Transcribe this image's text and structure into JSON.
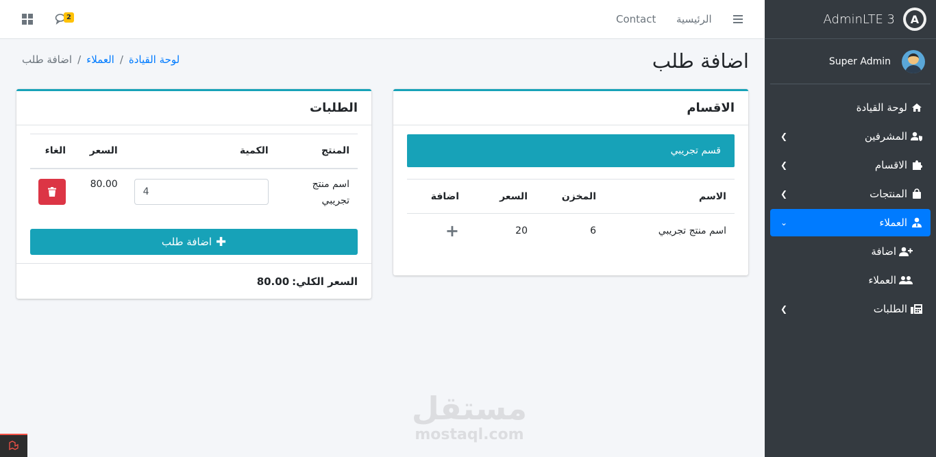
{
  "brand": {
    "name": "AdminLTE 3",
    "logo_letter": "A"
  },
  "user": {
    "name": "Super Admin"
  },
  "sidebar": {
    "items": [
      {
        "label": "لوحة القيادة",
        "icon": "home-icon",
        "chevron": false,
        "active": false
      },
      {
        "label": "المشرفين",
        "icon": "user-shield-icon",
        "chevron": true,
        "active": false
      },
      {
        "label": "الاقسام",
        "icon": "puzzle-icon",
        "chevron": true,
        "active": false
      },
      {
        "label": "المنتجات",
        "icon": "bag-icon",
        "chevron": true,
        "active": false
      },
      {
        "label": "العملاء",
        "icon": "user-tie-icon",
        "chevron": true,
        "active": true
      },
      {
        "label": "اضافة",
        "icon": "user-plus-icon",
        "chevron": false,
        "active": false,
        "sub": true
      },
      {
        "label": "العملاء",
        "icon": "users-icon",
        "chevron": false,
        "active": false,
        "sub": true
      },
      {
        "label": "الطلبات",
        "icon": "fax-icon",
        "chevron": true,
        "active": false
      }
    ]
  },
  "topnav": {
    "home": "الرئيسية",
    "contact": "Contact",
    "messages_count": "2"
  },
  "header": {
    "title": "اضافة طلب",
    "breadcrumb": [
      "لوحة القيادة",
      "العملاء",
      "اضافة طلب"
    ]
  },
  "categories_card": {
    "title": "الاقسام",
    "category_button": "قسم تجريبي",
    "columns": [
      "الاسم",
      "المخزن",
      "السعر",
      "اضافة"
    ],
    "rows": [
      {
        "name": "اسم منتج تجريبي",
        "stock": "6",
        "price": "20",
        "add": "+"
      }
    ]
  },
  "orders_card": {
    "title": "الطلبات",
    "columns": [
      "المنتج",
      "الكمية",
      "السعر",
      "الغاء"
    ],
    "rows": [
      {
        "product": "اسم منتج تجريبي",
        "quantity": "4",
        "price": "80.00"
      }
    ],
    "add_button": "اضافة طلب",
    "total_label": "السعر الكلي:",
    "total_value": "80.00"
  },
  "watermark": {
    "ar": "مستقل",
    "en": "mostaql.com"
  },
  "colors": {
    "accent": "#17a2b8",
    "primary": "#007bff",
    "danger": "#dc3545",
    "sidebar": "#343a40",
    "badge": "#ffc107"
  }
}
